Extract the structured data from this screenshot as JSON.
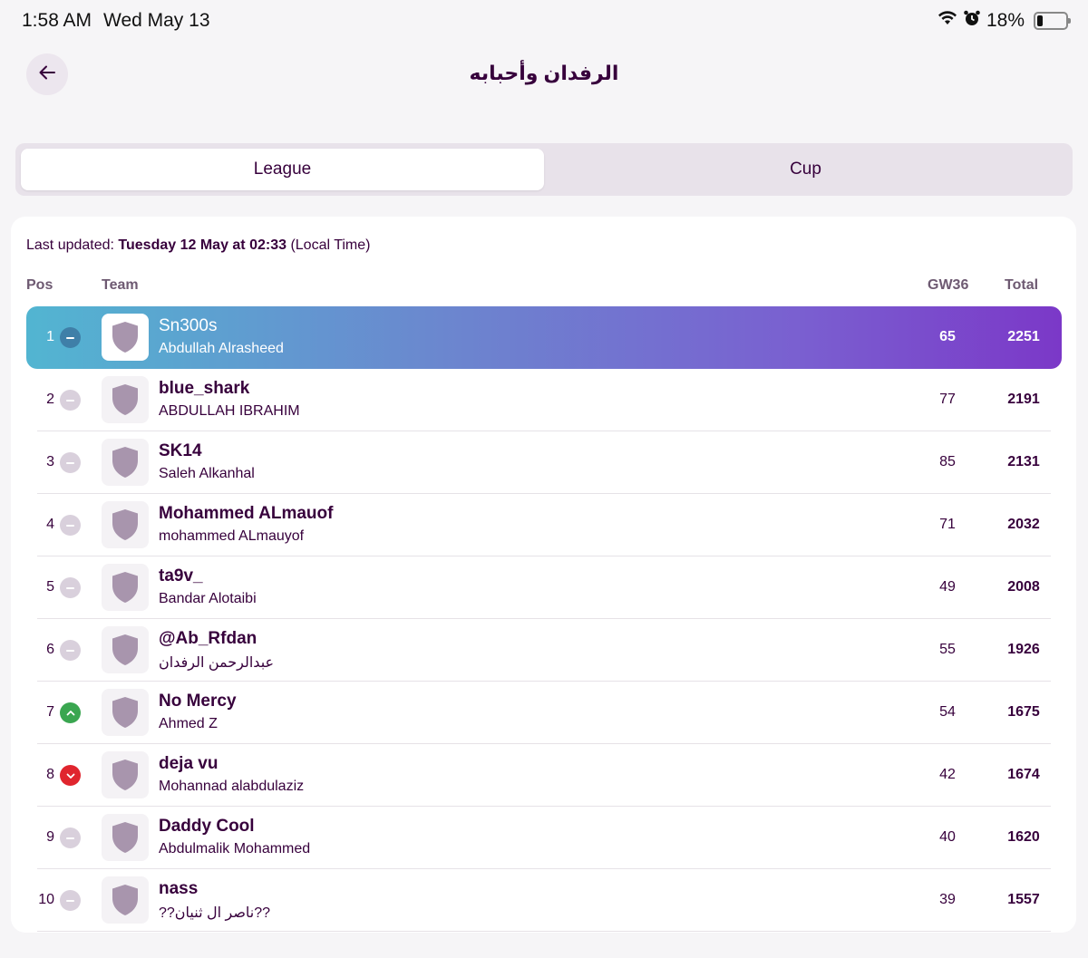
{
  "status_bar": {
    "time": "1:58 AM",
    "date": "Wed May 13",
    "battery": "18%",
    "icons": [
      "wifi-icon",
      "alarm-icon",
      "battery-icon"
    ]
  },
  "header": {
    "title": "الرفدان وأحبابه",
    "back_icon": "arrow-left-icon"
  },
  "tabs": [
    {
      "label": "League",
      "active": true
    },
    {
      "label": "Cup",
      "active": false
    }
  ],
  "last_updated": {
    "prefix": "Last updated:",
    "value": "Tuesday 12 May at 02:33",
    "suffix": "(Local Time)"
  },
  "table": {
    "headers": {
      "pos": "Pos",
      "team": "Team",
      "gw": "GW36",
      "total": "Total"
    },
    "rows": [
      {
        "pos": "1",
        "movement": "same",
        "team": "Sn300s",
        "manager": "Abdullah Alrasheed",
        "gw": "65",
        "total": "2251"
      },
      {
        "pos": "2",
        "movement": "same",
        "team": "blue_shark",
        "manager": "ABDULLAH IBRAHIM",
        "gw": "77",
        "total": "2191"
      },
      {
        "pos": "3",
        "movement": "same",
        "team": "SK14",
        "manager": "Saleh Alkanhal",
        "gw": "85",
        "total": "2131"
      },
      {
        "pos": "4",
        "movement": "same",
        "team": "Mohammed ALmauof",
        "manager": "mohammed ALmauyof",
        "gw": "71",
        "total": "2032"
      },
      {
        "pos": "5",
        "movement": "same",
        "team": "ta9v_",
        "manager": "Bandar Alotaibi",
        "gw": "49",
        "total": "2008"
      },
      {
        "pos": "6",
        "movement": "same",
        "team": "@Ab_Rfdan",
        "manager": "عبدالرحمن الرفدان",
        "gw": "55",
        "total": "1926"
      },
      {
        "pos": "7",
        "movement": "up",
        "team": "No Mercy",
        "manager": "Ahmed Z",
        "gw": "54",
        "total": "1675"
      },
      {
        "pos": "8",
        "movement": "down",
        "team": "deja vu",
        "manager": "Mohannad alabdulaziz",
        "gw": "42",
        "total": "1674"
      },
      {
        "pos": "9",
        "movement": "same",
        "team": "Daddy Cool",
        "manager": "Abdulmalik Mohammed",
        "gw": "40",
        "total": "1620"
      },
      {
        "pos": "10",
        "movement": "same",
        "team": "nass",
        "manager": "??ناصر ال ثنيان??",
        "gw": "39",
        "total": "1557"
      }
    ]
  },
  "colors": {
    "brand_purple": "#37003c",
    "leader_gradient_start": "#52b5d1",
    "leader_gradient_end": "#7b38c8",
    "up": "#3aa650",
    "down": "#e0252e",
    "same": "#d9d0dc"
  }
}
